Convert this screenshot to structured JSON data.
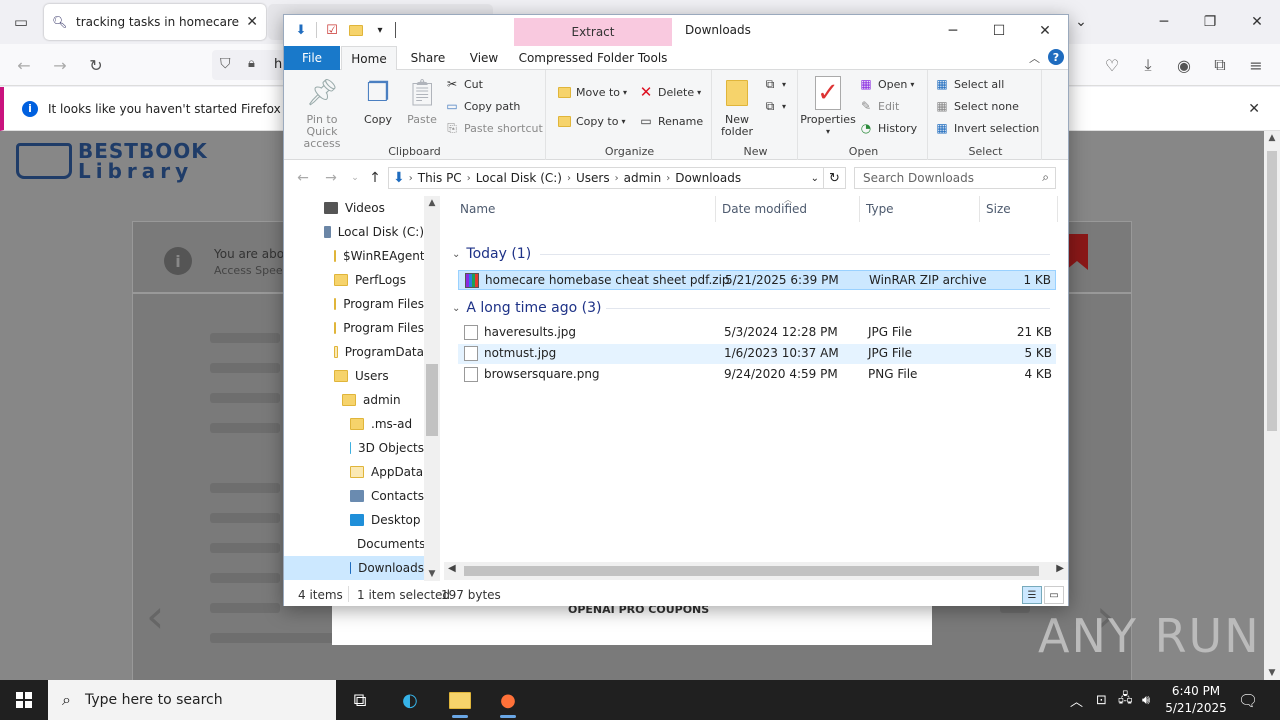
{
  "browser": {
    "tab_title": "tracking tasks in homecare hom",
    "url_partial": "h",
    "notice": "It looks like you haven't started Firefox in a wh"
  },
  "page": {
    "logo_line1": "BESTBOOK",
    "logo_line2": "Library",
    "note_line1": "You are abou",
    "note_line2": "Access Speed",
    "coupon": "OPENAI PRO COUPONS",
    "watermark": "ANY RUN"
  },
  "explorer": {
    "contextual_tab_group": "Extract",
    "window_title": "Downloads",
    "tabs": [
      "File",
      "Home",
      "Share",
      "View",
      "Compressed Folder Tools"
    ],
    "ribbon": {
      "clipboard": {
        "label": "Clipboard",
        "pin": "Pin to Quick access",
        "copy": "Copy",
        "paste": "Paste",
        "cut": "Cut",
        "copy_path": "Copy path",
        "paste_shortcut": "Paste shortcut"
      },
      "organize": {
        "label": "Organize",
        "move_to": "Move to",
        "copy_to": "Copy to",
        "delete": "Delete",
        "rename": "Rename"
      },
      "new": {
        "label": "New",
        "new_folder": "New folder"
      },
      "open": {
        "label": "Open",
        "properties": "Properties",
        "open": "Open",
        "edit": "Edit",
        "history": "History"
      },
      "select": {
        "label": "Select",
        "select_all": "Select all",
        "select_none": "Select none",
        "invert": "Invert selection"
      }
    },
    "address": [
      "This PC",
      "Local Disk (C:)",
      "Users",
      "admin",
      "Downloads"
    ],
    "search_placeholder": "Search Downloads",
    "tree": [
      {
        "label": "Videos",
        "indent": 0,
        "kind": "video"
      },
      {
        "label": "Local Disk (C:)",
        "indent": 0,
        "kind": "drive"
      },
      {
        "label": "$WinREAgent",
        "indent": 1,
        "kind": "folder-light"
      },
      {
        "label": "PerfLogs",
        "indent": 1,
        "kind": "folder"
      },
      {
        "label": "Program Files",
        "indent": 1,
        "kind": "folder"
      },
      {
        "label": "Program Files",
        "indent": 1,
        "kind": "folder"
      },
      {
        "label": "ProgramData",
        "indent": 1,
        "kind": "folder-light"
      },
      {
        "label": "Users",
        "indent": 1,
        "kind": "folder"
      },
      {
        "label": "admin",
        "indent": 2,
        "kind": "folder"
      },
      {
        "label": ".ms-ad",
        "indent": 3,
        "kind": "folder"
      },
      {
        "label": "3D Objects",
        "indent": 3,
        "kind": "3d"
      },
      {
        "label": "AppData",
        "indent": 3,
        "kind": "folder-light"
      },
      {
        "label": "Contacts",
        "indent": 3,
        "kind": "contacts"
      },
      {
        "label": "Desktop",
        "indent": 3,
        "kind": "desktop"
      },
      {
        "label": "Documents",
        "indent": 3,
        "kind": "docs"
      },
      {
        "label": "Downloads",
        "indent": 3,
        "kind": "downloads"
      }
    ],
    "columns": [
      "Name",
      "Date modified",
      "Type",
      "Size"
    ],
    "groups": [
      {
        "title": "Today (1)",
        "files": [
          {
            "name": "homecare homebase cheat sheet pdf.zip",
            "date": "5/21/2025 6:39 PM",
            "type": "WinRAR ZIP archive",
            "size": "1 KB"
          }
        ]
      },
      {
        "title": "A long time ago (3)",
        "files": [
          {
            "name": "haveresults.jpg",
            "date": "5/3/2024 12:28 PM",
            "type": "JPG File",
            "size": "21 KB"
          },
          {
            "name": "notmust.jpg",
            "date": "1/6/2023 10:37 AM",
            "type": "JPG File",
            "size": "5 KB"
          },
          {
            "name": "browsersquare.png",
            "date": "9/24/2020 4:59 PM",
            "type": "PNG File",
            "size": "4 KB"
          }
        ]
      }
    ],
    "status": {
      "items": "4 items",
      "selected": "1 item selected",
      "bytes": "197 bytes"
    }
  },
  "taskbar": {
    "search_placeholder": "Type here to search",
    "time": "6:40 PM",
    "date": "5/21/2025"
  }
}
